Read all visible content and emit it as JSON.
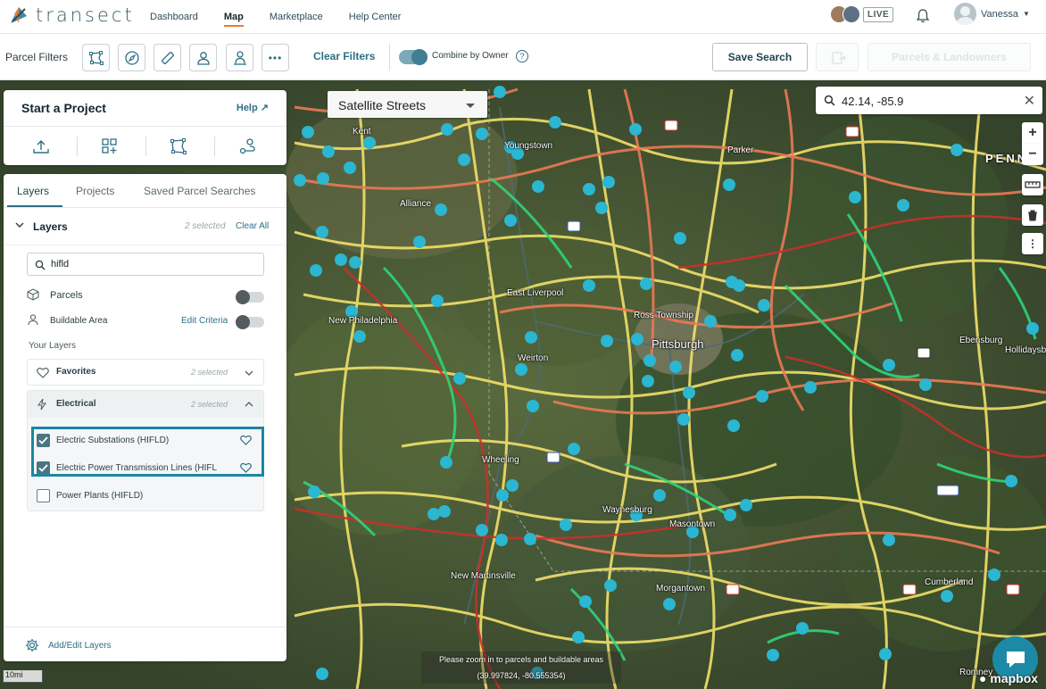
{
  "nav": {
    "logo": "transect",
    "items": [
      "Dashboard",
      "Map",
      "Marketplace",
      "Help Center"
    ],
    "active": "Map",
    "live_badge": "LIVE",
    "user_name": "Vanessa"
  },
  "filters": {
    "label": "Parcel Filters",
    "clear": "Clear Filters",
    "combine": "Combine by Owner",
    "help": "?",
    "save_search": "Save Search",
    "parcels_landowners": "Parcels & Landowners"
  },
  "project": {
    "title": "Start a Project",
    "help": "Help"
  },
  "layers_panel": {
    "tabs": [
      "Layers",
      "Projects",
      "Saved Parcel Searches"
    ],
    "header": "Layers",
    "selected": "2 selected",
    "clear_all": "Clear All",
    "search_value": "hifld",
    "parcels": "Parcels",
    "buildable": "Buildable Area",
    "edit_criteria": "Edit Criteria",
    "your_layers": "Your Layers",
    "favorites": "Favorites",
    "favorites_selected": "2 selected",
    "electrical": "Electrical",
    "electrical_selected": "2 selected",
    "layer1": "Electric Substations (HIFLD)",
    "layer2": "Electric Power Transmission Lines (HIFL",
    "layer3": "Power Plants (HIFLD)",
    "add_edit": "Add/Edit Layers"
  },
  "map": {
    "basemap": "Satellite Streets",
    "search_value": "42.14, -85.9",
    "zoom_msg": "Please zoom in to parcels and buildable areas",
    "coords": "(39.997824, -80.555354)",
    "scale": "10mi",
    "attribution": "mapbox",
    "labels": {
      "pittsburgh": "Pittsburgh",
      "east_liverpool": "East Liverpool",
      "ross_township": "Ross Township",
      "weirton": "Weirton",
      "wheeling": "Wheeling",
      "waynesburg": "Waynesburg",
      "masontown": "Masontown",
      "morgantown": "Morgantown",
      "new_martinsville": "New Martinsville",
      "new_philadelphia": "New Philadelphia",
      "alliance": "Alliance",
      "ebensburg": "Ebensburg",
      "hollidaysburg": "Hollidaysburg",
      "cumberland": "Cumberland",
      "romney": "Romney",
      "parker": "Parker",
      "kent": "Kent",
      "youngstown": "Youngstown",
      "penn": "PENN"
    }
  },
  "colors": {
    "accent": "#2d6f85",
    "highlight": "#1a86a3",
    "substation": "#2bb6d1"
  }
}
